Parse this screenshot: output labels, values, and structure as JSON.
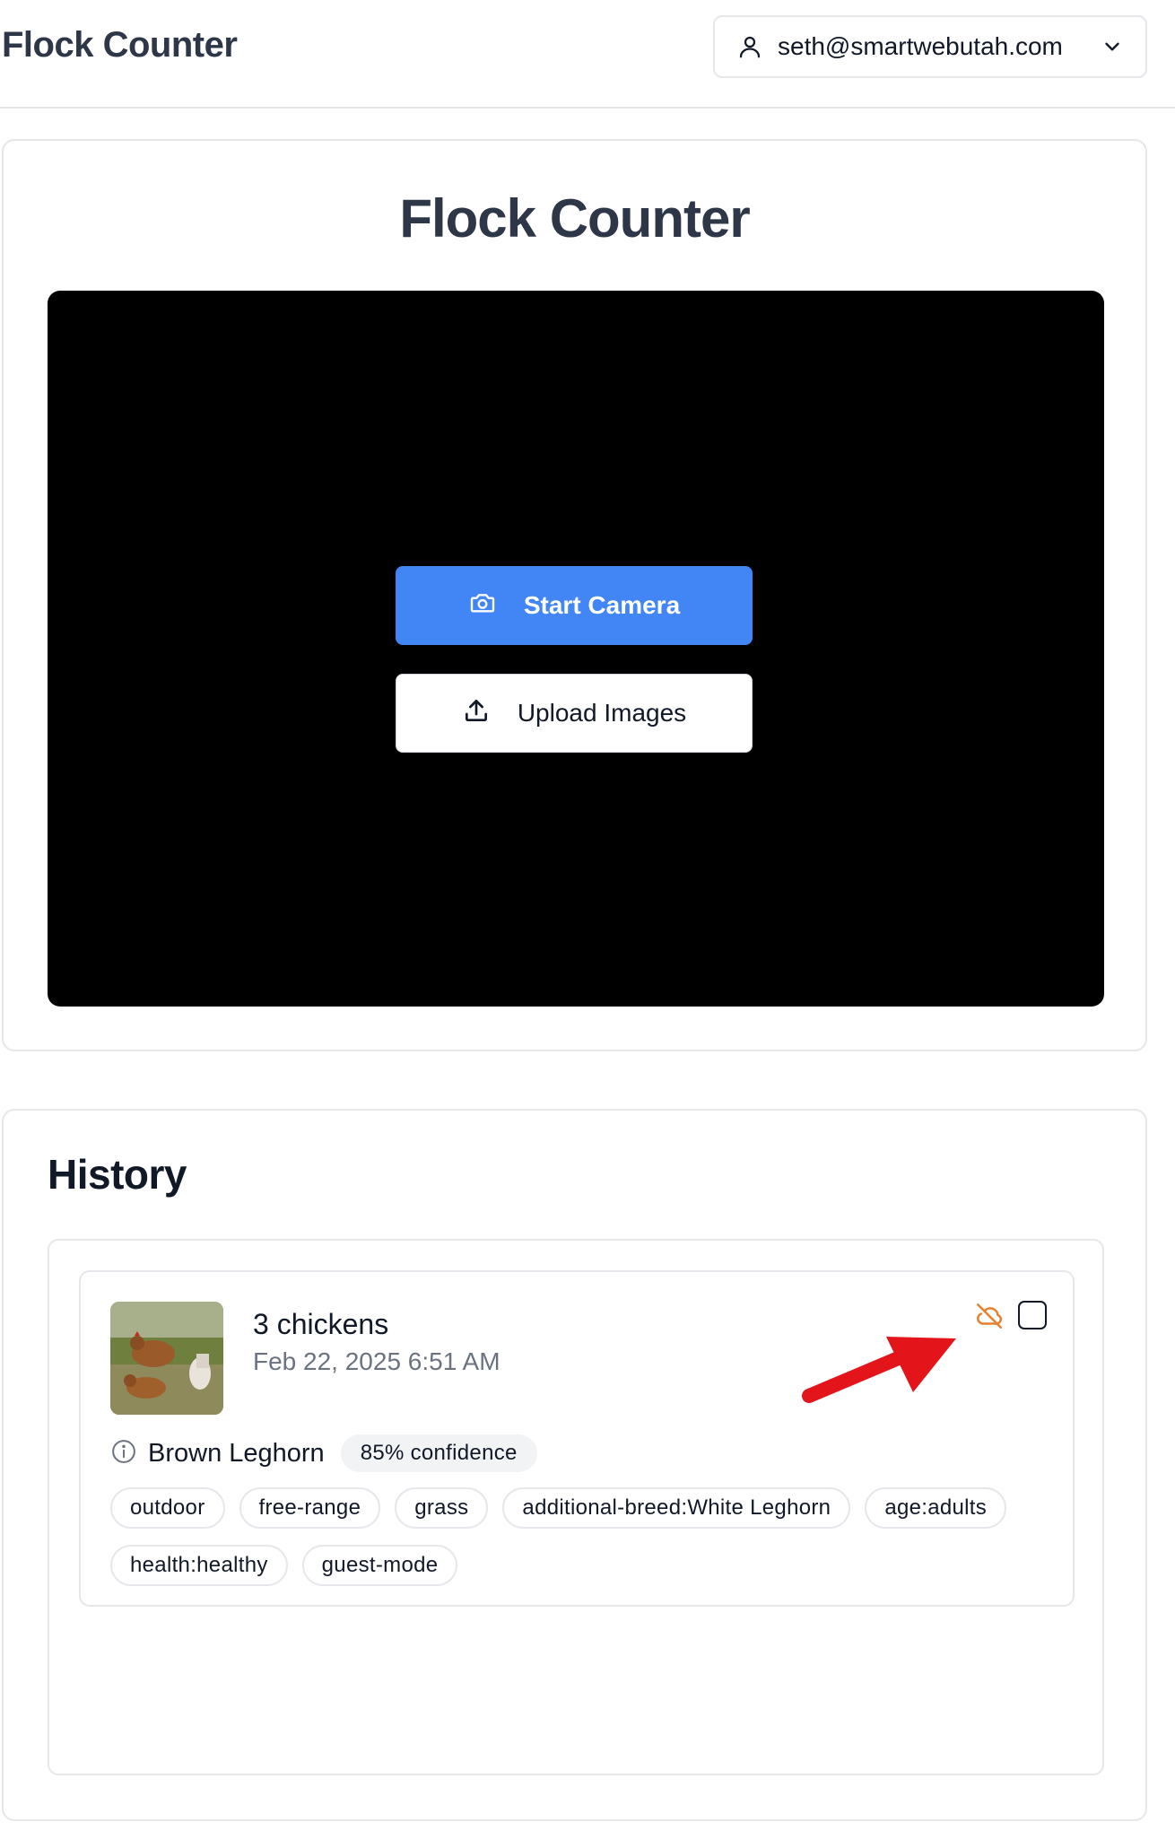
{
  "header": {
    "app_title": "Flock Counter",
    "user_email": "seth@smartwebutah.com",
    "icons": {
      "user": "user-icon",
      "dropdown": "chevron-down-icon"
    }
  },
  "main": {
    "title": "Flock Counter",
    "start_camera_label": "Start Camera",
    "upload_images_label": "Upload Images",
    "icons": {
      "camera": "camera-icon",
      "upload": "upload-icon"
    }
  },
  "history": {
    "title": "History",
    "items": [
      {
        "count_label": "3 chickens",
        "date": "Feb 22, 2025 6:51 AM",
        "breed": "Brown Leghorn",
        "confidence": "85% confidence",
        "sync_status_icon": "cloud-off-icon",
        "selected": false,
        "tags": [
          "outdoor",
          "free-range",
          "grass",
          "additional-breed:White Leghorn",
          "age:adults",
          "health:healthy",
          "guest-mode"
        ]
      }
    ]
  },
  "colors": {
    "primary_button": "#4285f4",
    "camera_background": "#000000",
    "sync_off_icon": "#e8802e",
    "annotation_arrow": "#e3151a",
    "title_text": "#2d3748"
  }
}
